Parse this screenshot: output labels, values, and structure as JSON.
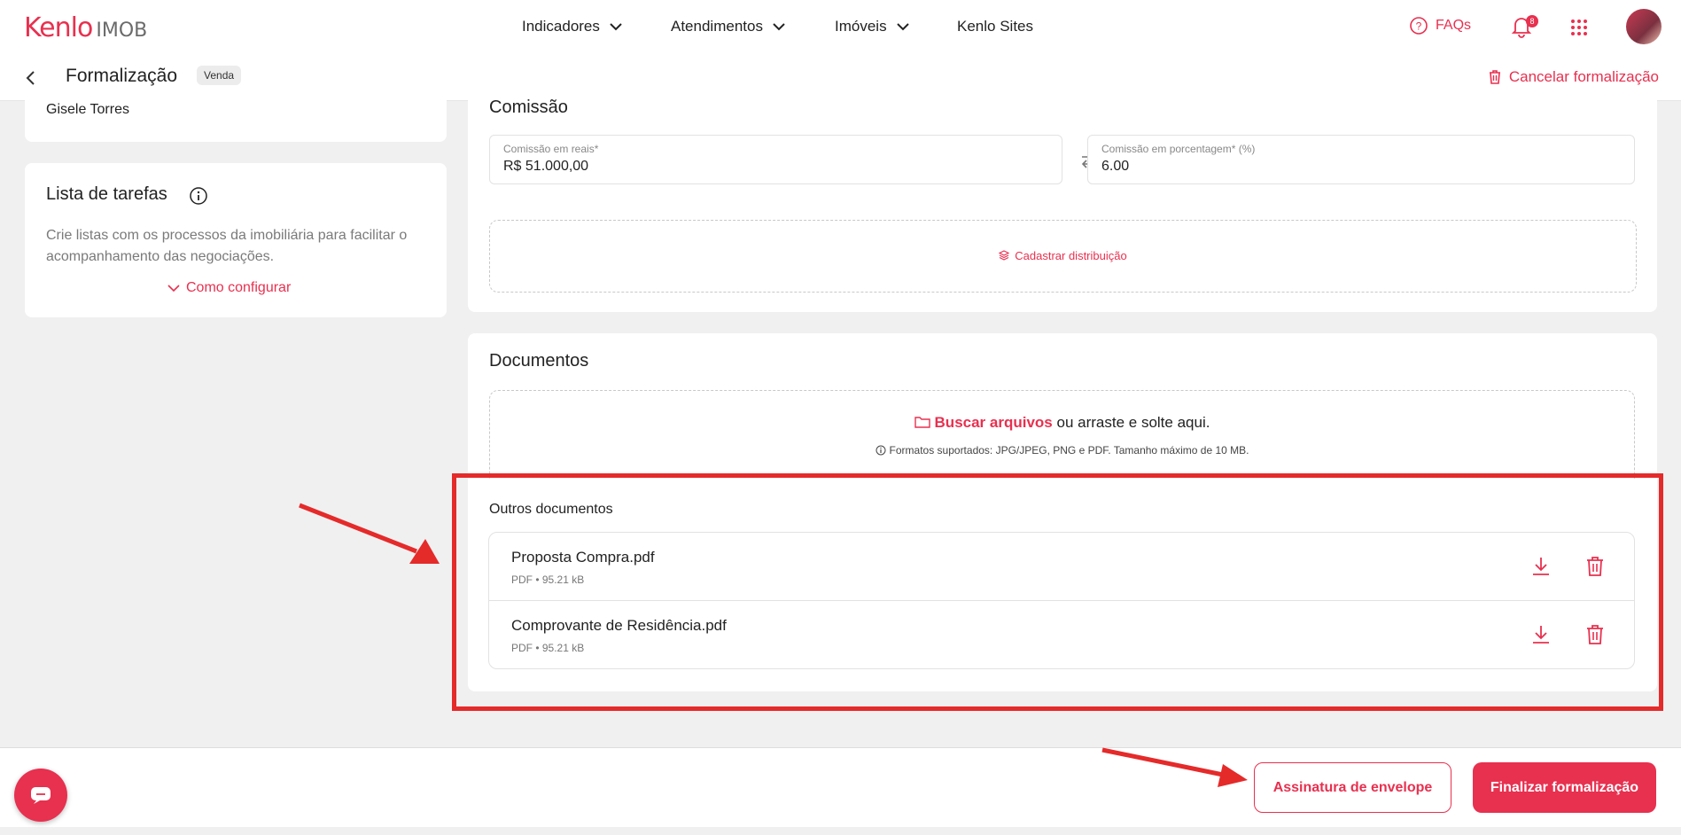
{
  "brand": {
    "logo_main": "Kenlo",
    "logo_sub": "IMOB",
    "accent_color": "#e8304f"
  },
  "nav": {
    "items": [
      {
        "label": "Indicadores"
      },
      {
        "label": "Atendimentos"
      },
      {
        "label": "Imóveis"
      },
      {
        "label": "Kenlo Sites"
      }
    ],
    "faq": "FAQs",
    "notif_count": "8"
  },
  "subbar": {
    "title": "Formalização",
    "tag": "Venda",
    "cancel": "Cancelar formalização"
  },
  "left": {
    "person": "Gisele Torres",
    "tasks_title": "Lista de tarefas",
    "tasks_desc": "Crie listas com os processos da imobiliária para facilitar o acompanhamento das negociações.",
    "tasks_link": "Como configurar"
  },
  "commission": {
    "title": "Comissão",
    "reais_label": "Comissão em reais*",
    "reais_value": "R$ 51.000,00",
    "pct_label": "Comissão em porcentagem* (%)",
    "pct_value": "6.00",
    "distribution": "Cadastrar distribuição"
  },
  "documents": {
    "title": "Documentos",
    "upload_link": "Buscar arquivos",
    "upload_rest": "ou arraste e solte aqui.",
    "formats": "Formatos suportados: JPG/JPEG, PNG e PDF. Tamanho máximo de 10 MB.",
    "others_title": "Outros documentos",
    "files": [
      {
        "name": "Proposta Compra.pdf",
        "meta": "PDF • 95.21 kB"
      },
      {
        "name": "Comprovante de Residência.pdf",
        "meta": "PDF • 95.21 kB"
      }
    ]
  },
  "footer": {
    "envelope": "Assinatura de envelope",
    "finalize": "Finalizar formalização"
  }
}
